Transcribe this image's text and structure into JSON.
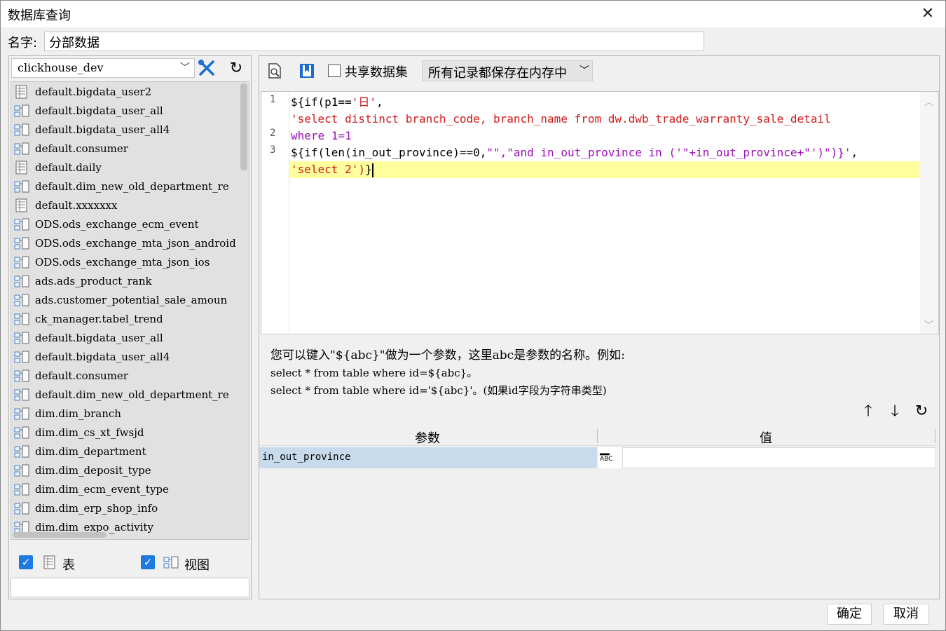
{
  "dialog": {
    "title": "数据库查询"
  },
  "name_row": {
    "label": "名字:",
    "value": "分部数据"
  },
  "datasource": {
    "selected": "clickhouse_dev"
  },
  "tree": {
    "items": [
      {
        "label": "default.bigdata_user2",
        "kind": "table"
      },
      {
        "label": "default.bigdata_user_all",
        "kind": "view"
      },
      {
        "label": "default.bigdata_user_all4",
        "kind": "view"
      },
      {
        "label": "default.consumer",
        "kind": "view"
      },
      {
        "label": "default.daily",
        "kind": "table"
      },
      {
        "label": "default.dim_new_old_department_re",
        "kind": "view"
      },
      {
        "label": "default.xxxxxxx",
        "kind": "table"
      },
      {
        "label": "ODS.ods_exchange_ecm_event",
        "kind": "view"
      },
      {
        "label": "ODS.ods_exchange_mta_json_android",
        "kind": "view"
      },
      {
        "label": "ODS.ods_exchange_mta_json_ios",
        "kind": "view"
      },
      {
        "label": "ads.ads_product_rank",
        "kind": "view"
      },
      {
        "label": "ads.customer_potential_sale_amoun",
        "kind": "view"
      },
      {
        "label": "ck_manager.tabel_trend",
        "kind": "view"
      },
      {
        "label": "default.bigdata_user_all",
        "kind": "view"
      },
      {
        "label": "default.bigdata_user_all4",
        "kind": "view"
      },
      {
        "label": "default.consumer",
        "kind": "view"
      },
      {
        "label": "default.dim_new_old_department_re",
        "kind": "view"
      },
      {
        "label": "dim.dim_branch",
        "kind": "view"
      },
      {
        "label": "dim.dim_cs_xt_fwsjd",
        "kind": "view"
      },
      {
        "label": "dim.dim_department",
        "kind": "view"
      },
      {
        "label": "dim.dim_deposit_type",
        "kind": "view"
      },
      {
        "label": "dim.dim_ecm_event_type",
        "kind": "view"
      },
      {
        "label": "dim.dim_erp_shop_info",
        "kind": "view"
      },
      {
        "label": "dim.dim_expo_activity",
        "kind": "view"
      }
    ]
  },
  "filters": {
    "table_label": "表",
    "view_label": "视图"
  },
  "toolbar": {
    "share_label": "共享数据集",
    "memory_select": "所有记录都保存在内存中"
  },
  "editor": {
    "line_numbers": [
      "1",
      "2",
      "3"
    ],
    "lines": [
      [
        {
          "t": "${if(p1==",
          "c": "black"
        },
        {
          "t": "'日'",
          "c": "red"
        },
        {
          "t": ",",
          "c": "black"
        }
      ],
      [
        {
          "t": "'select distinct branch_code, branch_name from dw.dwb_trade_warranty_sale_detail",
          "c": "red"
        }
      ],
      [
        {
          "t": "where 1=1",
          "c": "purple"
        }
      ],
      [
        {
          "t": "${if(len(in_out_province)==0,",
          "c": "black"
        },
        {
          "t": "\"\",\"and in_out_province in ('\"+in_out_province+\"')\")}'",
          "c": "purple"
        },
        {
          "t": ",",
          "c": "black"
        }
      ],
      [
        {
          "t": "'select 2')",
          "c": "red"
        },
        {
          "t": "}",
          "c": "black"
        }
      ]
    ]
  },
  "hint": {
    "line1": "您可以键入\"${abc}\"做为一个参数，这里abc是参数的名称。例如:",
    "line2": "select * from table where id=${abc}。",
    "line3": "select * from table where id='${abc}'。(如果id字段为字符串类型)"
  },
  "params": {
    "col_param": "参数",
    "col_value": "值",
    "rows": [
      {
        "name": "in_out_province",
        "type_icon": "ABC",
        "value": ""
      }
    ]
  },
  "buttons": {
    "ok": "确定",
    "cancel": "取消"
  },
  "colors": {
    "accent_blue": "#1f7ae0",
    "selected_row": "#c7dbec",
    "current_line": "#ffff9e"
  }
}
